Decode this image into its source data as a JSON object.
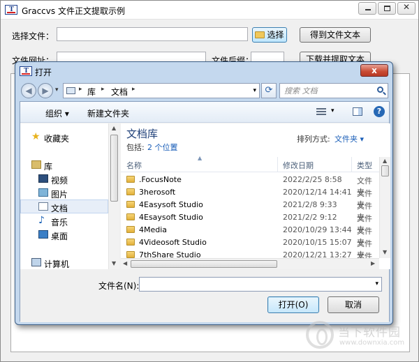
{
  "main_window": {
    "title": "Graccvs 文件正文提取示例",
    "icon_text": "T"
  },
  "form": {
    "select_file_label": "选择文件：",
    "select_file_value": "",
    "choose_button": "选择",
    "get_text_button": "得到文件文本",
    "file_url_label": "文件网址：",
    "file_url_value": "",
    "file_ext_label": "文件后缀：",
    "file_ext_value": "",
    "download_extract_button": "下载并提取文本"
  },
  "dialog": {
    "title": "打开",
    "close_label": "x",
    "breadcrumb": [
      "库",
      "文档"
    ],
    "search_placeholder": "搜索 文档",
    "toolbar": {
      "organize": "组织 ▾",
      "new_folder": "新建文件夹",
      "help": "?"
    },
    "nav": {
      "favorites": "收藏夹",
      "libraries": "库",
      "videos": "视频",
      "pictures": "图片",
      "documents": "文档",
      "music": "音乐",
      "desktop": "桌面",
      "computer": "计算机"
    },
    "content": {
      "library_title": "文档库",
      "includes_label": "包括:",
      "includes_link": "2 个位置",
      "arrange_label": "排列方式:",
      "arrange_value": "文件夹 ▾",
      "columns": [
        "名称",
        "修改日期",
        "类型"
      ],
      "files": [
        {
          "name": ".FocusNote",
          "date": "2022/2/25 8:58",
          "type": "文件夹"
        },
        {
          "name": "3herosoft",
          "date": "2020/12/14 14:41",
          "type": "文件夹"
        },
        {
          "name": "4Easysoft Studio",
          "date": "2021/2/8 9:33",
          "type": "文件夹"
        },
        {
          "name": "4Esaysoft Studio",
          "date": "2021/2/2 9:12",
          "type": "文件夹"
        },
        {
          "name": "4Media",
          "date": "2020/10/29 13:44",
          "type": "文件夹"
        },
        {
          "name": "4Videosoft Studio",
          "date": "2020/10/15 15:07",
          "type": "文件夹"
        },
        {
          "name": "7thShare Studio",
          "date": "2020/12/21 13:27",
          "type": "文件夹"
        }
      ]
    },
    "footer": {
      "filename_label": "文件名(N):",
      "filename_value": "",
      "open_button": "打开(O)",
      "cancel_button": "取消"
    }
  },
  "watermark": {
    "text": "当下软件园",
    "url": "www.downxia.com"
  },
  "colors": {
    "dialog_frame": "#c4d8ee",
    "link_blue": "#1a5eb8",
    "library_title": "#1e3f78",
    "close_red": "#c84a33"
  },
  "icons": {
    "favorites": "star-icon",
    "folder": "folder-icon",
    "search": "search-icon",
    "refresh": "refresh-icon",
    "help": "help-icon"
  }
}
